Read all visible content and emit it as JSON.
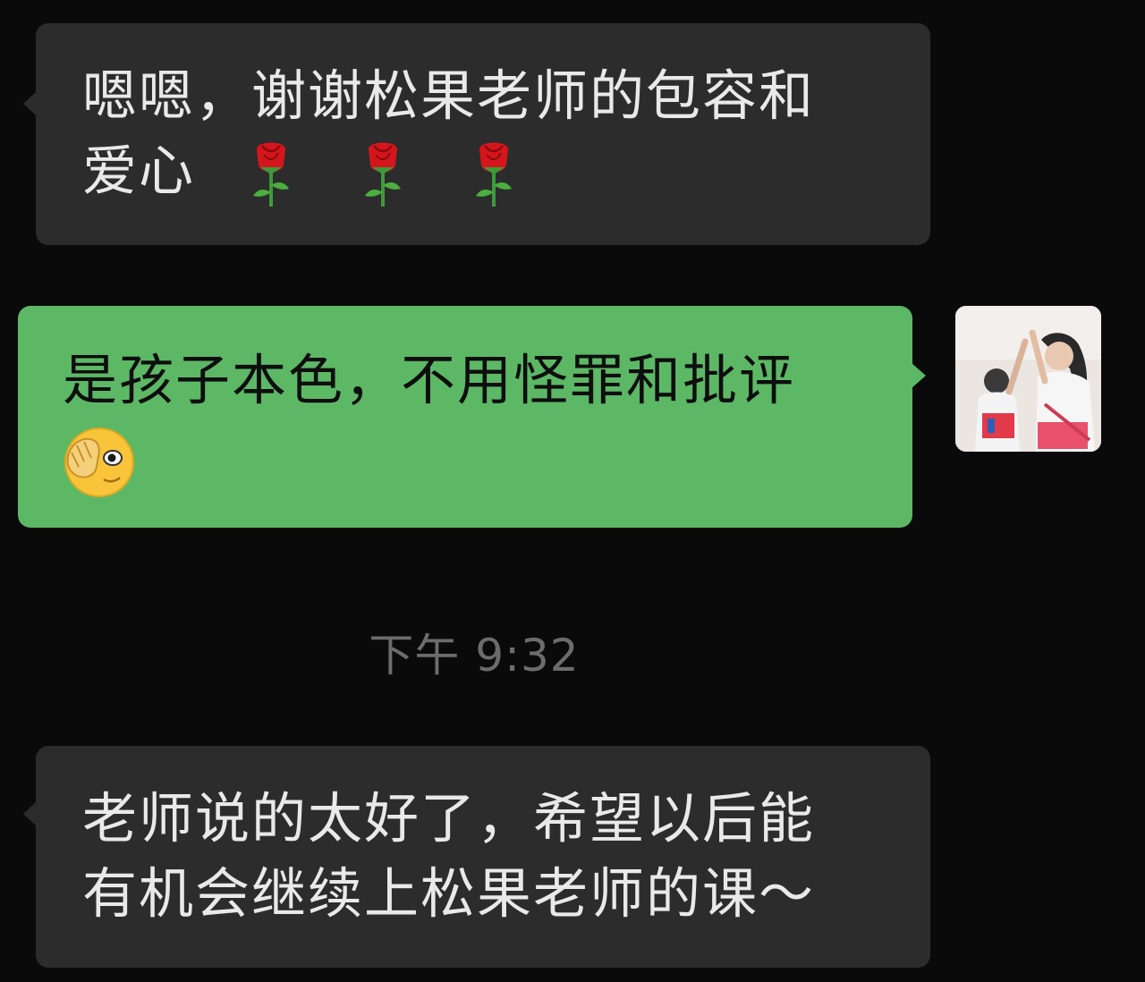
{
  "chat": {
    "messages": [
      {
        "direction": "incoming",
        "line1": "嗯嗯，谢谢松果老师的包容和",
        "line2_text": "爱心",
        "emojis": [
          "rose-emoji",
          "rose-emoji",
          "rose-emoji"
        ]
      },
      {
        "direction": "outgoing",
        "line1": "是孩子本色，不用怪罪和批评",
        "emojis": [
          "facepalm-peek-emoji"
        ]
      },
      {
        "direction": "incoming",
        "line1": "老师说的太好了，希望以后能",
        "line2": "有机会继续上松果老师的课～"
      }
    ],
    "timestamp": "下午 9:32"
  },
  "colors": {
    "background": "#0a0a0a",
    "incoming_bubble": "#2c2c2c",
    "outgoing_bubble": "#5db866",
    "timestamp_text": "#6c6c6c"
  }
}
